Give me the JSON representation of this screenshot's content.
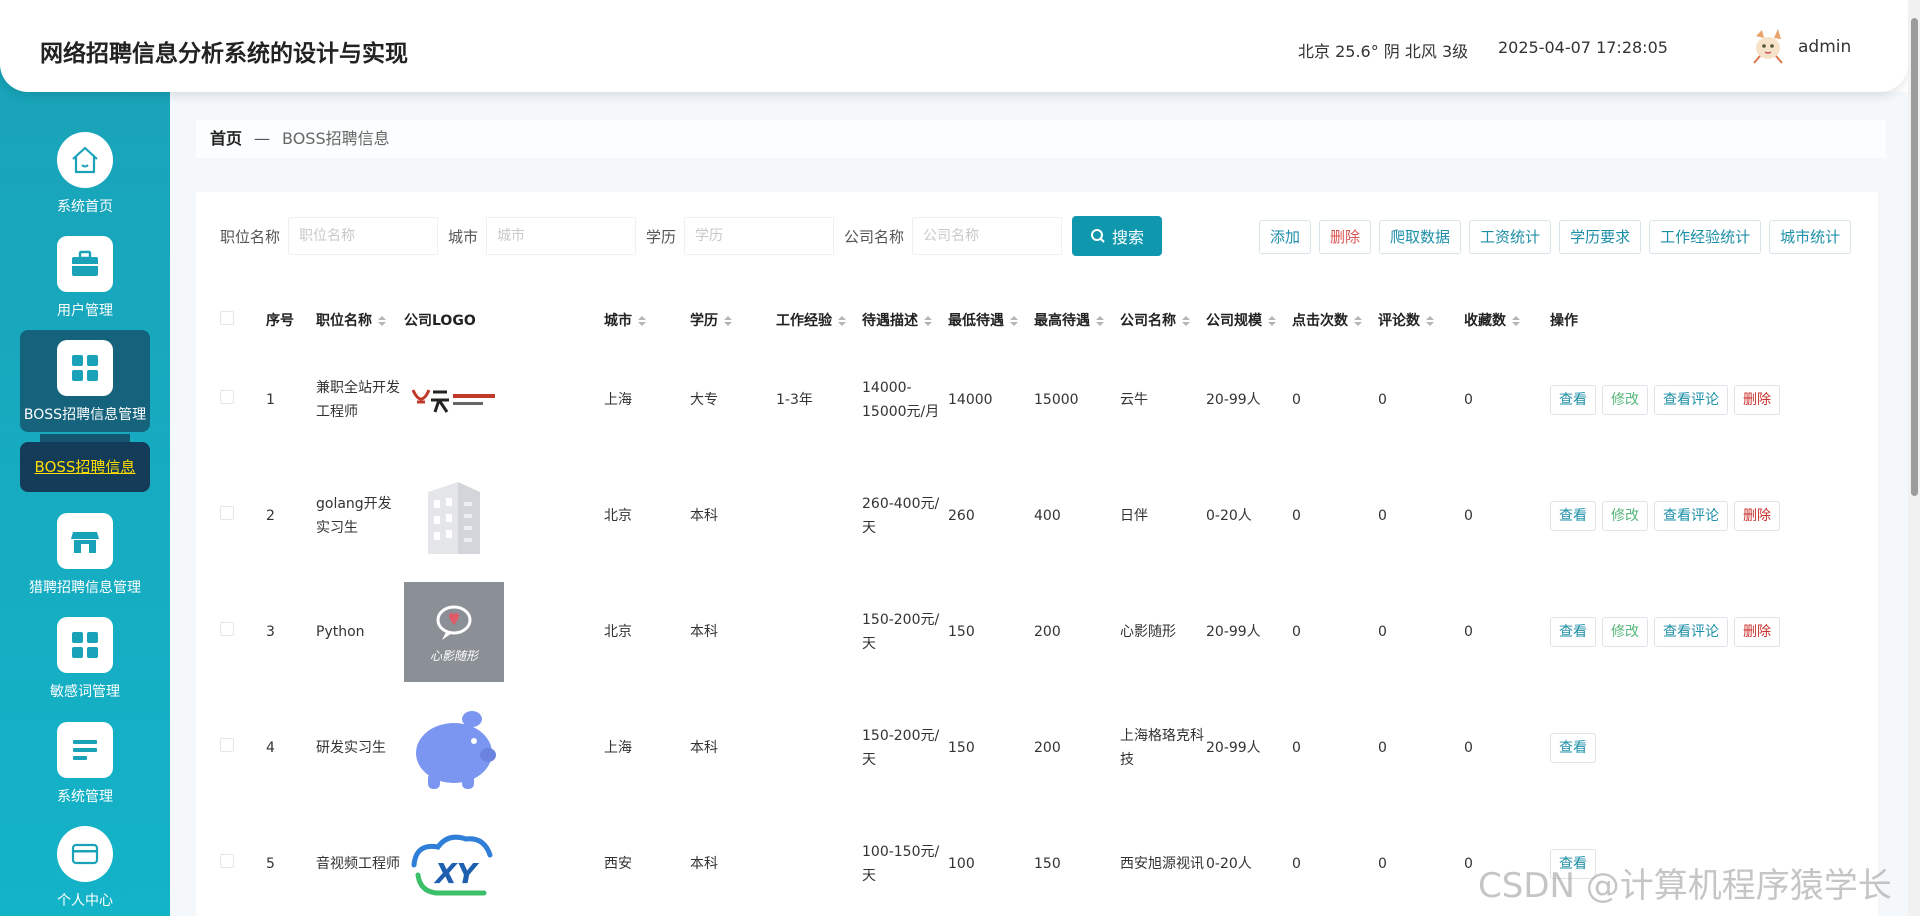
{
  "header": {
    "title": "网络招聘信息分析系统的设计与实现",
    "weather": "北京 25.6° 阴 北风 3级",
    "datetime": "2025-04-07 17:28:05",
    "username": "admin",
    "avatar_icon": "cartoon-avatar-icon"
  },
  "sidebar": {
    "items": [
      {
        "label": "系统首页",
        "icon": "home-icon"
      },
      {
        "label": "用户管理",
        "icon": "briefcase-icon"
      },
      {
        "label": "BOSS招聘信息管理",
        "icon": "grid-icon"
      },
      {
        "label": "猎聘招聘信息管理",
        "icon": "store-icon"
      },
      {
        "label": "敏感词管理",
        "icon": "grid-icon"
      },
      {
        "label": "系统管理",
        "icon": "list-icon"
      },
      {
        "label": "个人中心",
        "icon": "card-icon"
      }
    ],
    "active_sub": "BOSS招聘信息"
  },
  "breadcrumb": {
    "home": "首页",
    "separator": "—",
    "current": "BOSS招聘信息"
  },
  "search": {
    "fields": [
      {
        "label": "职位名称",
        "placeholder": "职位名称"
      },
      {
        "label": "城市",
        "placeholder": "城市"
      },
      {
        "label": "学历",
        "placeholder": "学历"
      },
      {
        "label": "公司名称",
        "placeholder": "公司名称"
      }
    ],
    "button": "搜索"
  },
  "actions": [
    "添加",
    "删除",
    "爬取数据",
    "工资统计",
    "学历要求",
    "工作经验统计",
    "城市统计"
  ],
  "table": {
    "headers": [
      "序号",
      "职位名称",
      "公司LOGO",
      "城市",
      "学历",
      "工作经验",
      "待遇描述",
      "最低待遇",
      "最高待遇",
      "公司名称",
      "公司规模",
      "点击次数",
      "评论数",
      "收藏数",
      "操作"
    ],
    "rows": [
      {
        "no": "1",
        "title": "兼职全站开发工程师",
        "city": "上海",
        "edu": "大专",
        "exp": "1-3年",
        "pay": "14000-15000元/月",
        "min": "14000",
        "max": "15000",
        "company": "云牛",
        "size": "20-99人",
        "clicks": "0",
        "comments": "0",
        "favs": "0",
        "logo": "yunniu-logo"
      },
      {
        "no": "2",
        "title": "golang开发实习生",
        "city": "北京",
        "edu": "本科",
        "exp": "",
        "pay": "260-400元/天",
        "min": "260",
        "max": "400",
        "company": "日伴",
        "size": "0-20人",
        "clicks": "0",
        "comments": "0",
        "favs": "0",
        "logo": "building-logo"
      },
      {
        "no": "3",
        "title": "Python",
        "city": "北京",
        "edu": "本科",
        "exp": "",
        "pay": "150-200元/天",
        "min": "150",
        "max": "200",
        "company": "心影随形",
        "size": "20-99人",
        "clicks": "0",
        "comments": "0",
        "favs": "0",
        "logo": "xinying-logo",
        "logo_text": "心影随形"
      },
      {
        "no": "4",
        "title": "研发实习生",
        "city": "上海",
        "edu": "本科",
        "exp": "",
        "pay": "150-200元/天",
        "min": "150",
        "max": "200",
        "company": "上海格珞克科技",
        "size": "20-99人",
        "clicks": "0",
        "comments": "0",
        "favs": "0",
        "logo": "piggy-logo"
      },
      {
        "no": "5",
        "title": "音视频工程师",
        "city": "西安",
        "edu": "本科",
        "exp": "",
        "pay": "100-150元/天",
        "min": "100",
        "max": "150",
        "company": "西安旭源视讯",
        "size": "0-20人",
        "clicks": "0",
        "comments": "0",
        "favs": "0",
        "logo": "xy-cloud-logo",
        "logo_text": "XY"
      }
    ],
    "ops": {
      "view": "查看",
      "edit": "修改",
      "reviews": "查看评论",
      "delete": "删除"
    }
  },
  "watermark": "CSDN @计算机程序猿学长",
  "colors": {
    "accent": "#0f97ad",
    "sidebar": "#13b3c8",
    "danger": "#c9302c",
    "edit": "#56b57a"
  }
}
